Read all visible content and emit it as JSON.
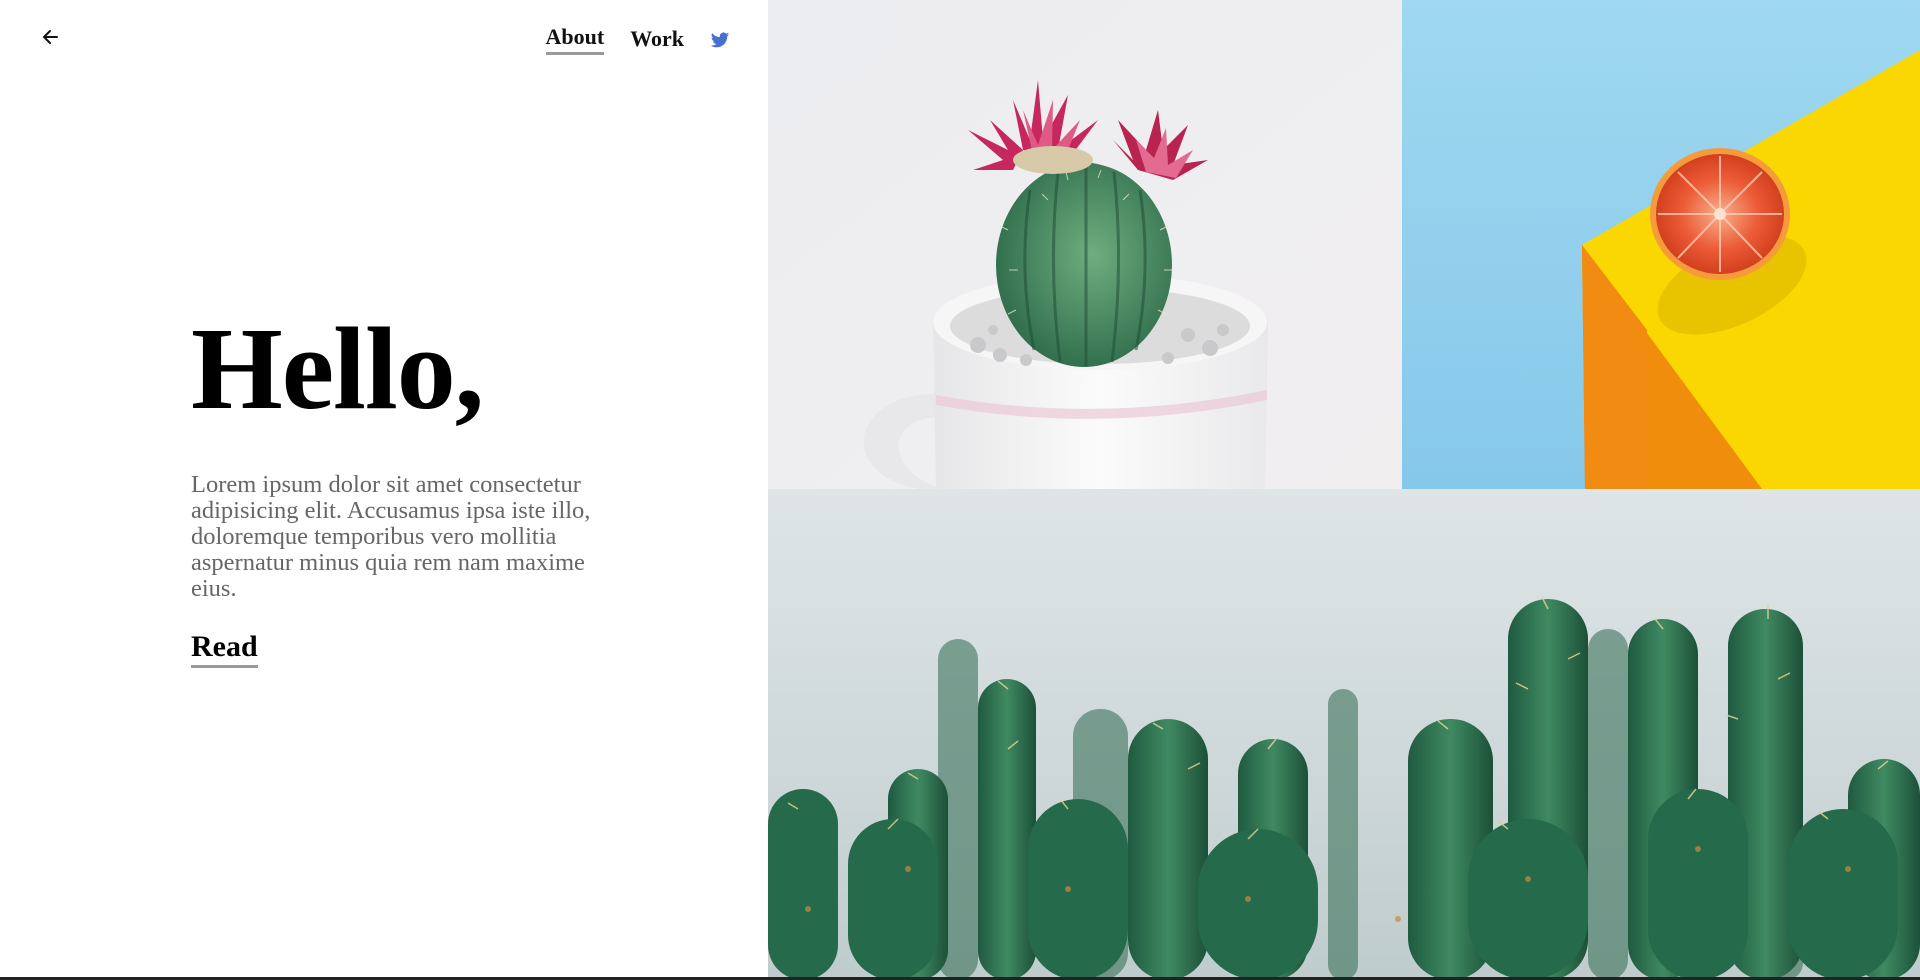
{
  "nav": {
    "back_icon": "arrow-left-icon",
    "links": [
      {
        "label": "About",
        "active": true
      },
      {
        "label": "Work",
        "active": false
      }
    ],
    "social_icon": "twitter-icon",
    "social_color": "#4a6fd1"
  },
  "hero": {
    "title": "Hello,",
    "body": "Lorem ipsum dolor sit amet consectetur adipisicing elit. Accusamus ipsa iste illo, doloremque temporibus vero mollitia aspernatur minus quia rem nam maxime eius.",
    "cta_label": "Read"
  },
  "gallery": {
    "images": [
      {
        "subject": "pink-flowering-cactus-in-white-mug"
      },
      {
        "subject": "half-grapefruit-on-yellow-cube-blue-background"
      },
      {
        "subject": "row-of-green-cacti"
      }
    ]
  },
  "colors": {
    "text": "#000000",
    "muted_text": "#666666",
    "underline": "#9a9a9a"
  }
}
